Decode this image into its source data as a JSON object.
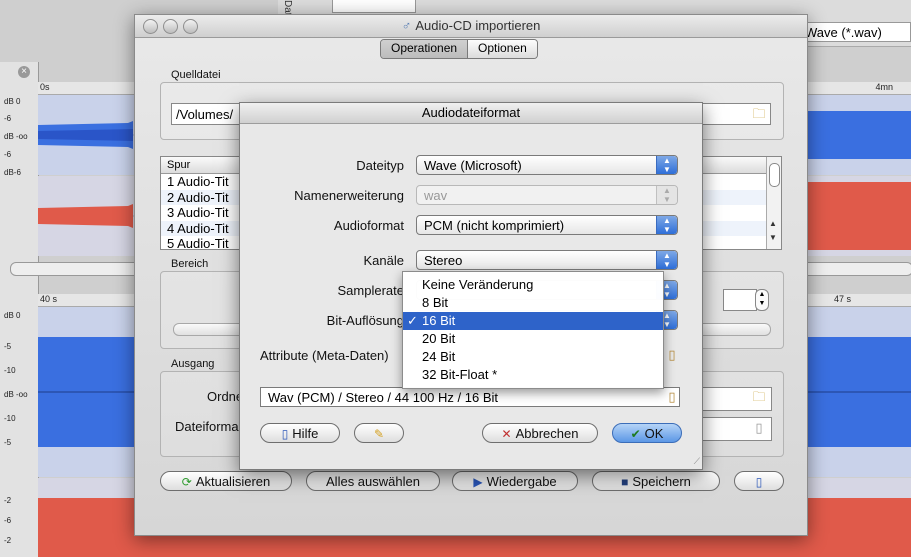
{
  "window": {
    "title": "Audio-CD importieren",
    "tabs": [
      {
        "label": "Operationen",
        "active": true
      },
      {
        "label": "Optionen",
        "active": false
      }
    ]
  },
  "background": {
    "format_field": "Wave (*.wav)",
    "ruler_top": {
      "left": "0s",
      "right": "4mn"
    },
    "ruler_mid": {
      "left": "40 s",
      "right": "47 s"
    },
    "scale_labels": [
      "dB 0",
      "-6",
      "dB -oo",
      "-6",
      "dB-6"
    ],
    "lower_scale_labels": [
      "dB 0",
      "-5",
      "-10",
      "dB -oo",
      "-10",
      "-5",
      "-2",
      "-6",
      "-2"
    ],
    "colors": {
      "blue_wave": "#3a6fe0",
      "red_wave": "#e05a4a",
      "wave_bg": "#c6cfe6"
    }
  },
  "dialog": {
    "quelldatei_label": "Quelldatei",
    "path_value": "/Volumes/",
    "track_header": "Spur",
    "tracks": [
      "1 Audio-Tit",
      "2 Audio-Tit",
      "3 Audio-Tit",
      "4 Audio-Tit",
      "5 Audio-Tit"
    ],
    "bereich_label": "Bereich",
    "ausgang_label": "Ausgang",
    "ordner_label": "Ordne",
    "dateiformat_label": "Dateiforma",
    "buttons": {
      "aktualisieren": "Aktualisieren",
      "alles_auswaehlen": "Alles auswählen",
      "wiedergabe": "Wiedergabe",
      "speichern": "Speichern"
    }
  },
  "sheet": {
    "title": "Audiodateiformat",
    "fields": {
      "dateityp": {
        "label": "Dateityp",
        "value": "Wave (Microsoft)"
      },
      "namenerweiterung": {
        "label": "Namenerweiterung",
        "value": "wav"
      },
      "audioformat": {
        "label": "Audioformat",
        "value": "PCM (nicht komprimiert)"
      },
      "kanaele": {
        "label": "Kanäle",
        "value": "Stereo"
      },
      "samplerate": {
        "label": "Samplerate"
      },
      "bitaufloesung": {
        "label": "Bit-Auflösung"
      },
      "attribute": {
        "label": "Attribute (Meta-Daten)"
      }
    },
    "summary": "Wav (PCM) / Stereo / 44 100 Hz / 16 Bit",
    "menu": {
      "items": [
        "Keine Veränderung",
        "8 Bit",
        "16 Bit",
        "20 Bit",
        "24 Bit",
        "32 Bit-Float *"
      ],
      "selected": "16 Bit",
      "check": "✓"
    },
    "buttons": {
      "hilfe": "Hilfe",
      "abbrechen": "Abbrechen",
      "ok": "OK"
    },
    "colors": {
      "ok_blue": "#6ea4ea",
      "selection": "#2e63c9"
    }
  }
}
